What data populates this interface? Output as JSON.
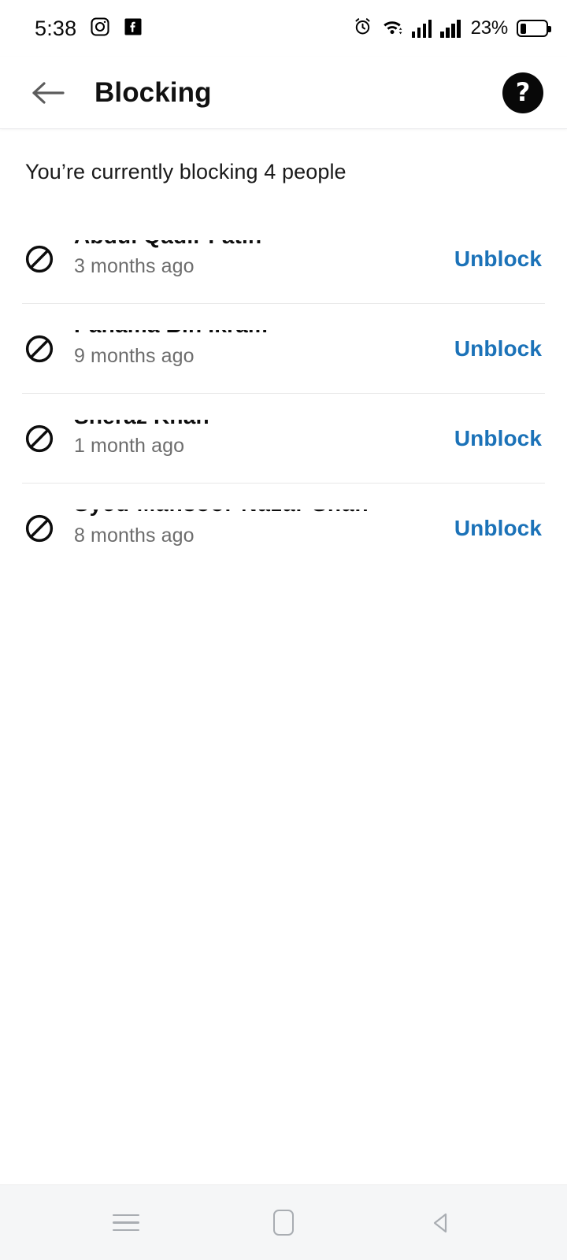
{
  "status_bar": {
    "time": "5:38",
    "battery_percent": "23%",
    "icons": [
      {
        "name": "instagram-icon"
      },
      {
        "name": "facebook-icon"
      },
      {
        "name": "alarm-clock-icon"
      },
      {
        "name": "wifi-icon"
      },
      {
        "name": "signal-sim1-icon"
      },
      {
        "name": "signal-sim2-icon"
      },
      {
        "name": "battery-icon"
      }
    ]
  },
  "app_bar": {
    "back_icon": "back-arrow-icon",
    "title": "Blocking",
    "help_icon": "help-question-icon",
    "help_glyph": "?"
  },
  "main": {
    "subtitle": "You’re currently blocking 4 people",
    "unblock_label": "Unblock",
    "blocked_people": [
      {
        "name": "Abdul Qadir Fatih",
        "timestamp": "3 months ago",
        "unblock_label": "Unblock"
      },
      {
        "name": "Pahama Bin Ikram",
        "timestamp": "9 months ago",
        "unblock_label": "Unblock"
      },
      {
        "name": "Sheraz Khan",
        "timestamp": "1 month ago",
        "unblock_label": "Unblock"
      },
      {
        "name": "Syed Mansoor Nazar Shah",
        "timestamp": "8 months ago",
        "unblock_label": "Unblock"
      }
    ]
  },
  "nav_bar": {
    "recents_icon": "recents-menu-icon",
    "home_icon": "home-square-icon",
    "back_icon": "back-triangle-icon"
  },
  "colors": {
    "link_blue": "#1b72b8",
    "text_primary": "#111111",
    "text_secondary": "#6d6d6d",
    "divider": "#e8e8e8",
    "nav_background": "#f5f6f7"
  }
}
